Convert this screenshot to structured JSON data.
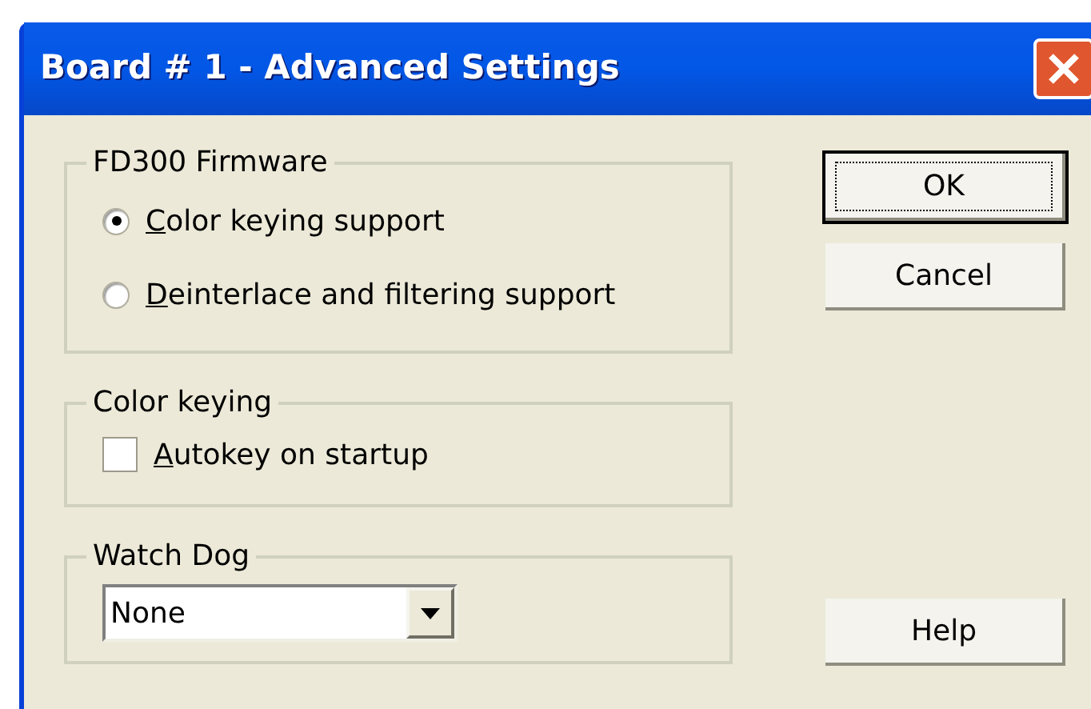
{
  "window": {
    "title": "Board # 1 - Advanced Settings"
  },
  "groups": [
    {
      "title": "FD300 Firmware",
      "items": [
        {
          "kind": "radio",
          "label": "Color keying support",
          "selected": true,
          "mnemonic_first": true
        },
        {
          "kind": "radio",
          "label": "Deinterlace and filtering support",
          "selected": false,
          "mnemonic_first": true
        }
      ]
    },
    {
      "title": "Color keying",
      "items": [
        {
          "kind": "checkbox",
          "label": "Autokey on startup",
          "checked": false,
          "mnemonic_first": true
        }
      ]
    },
    {
      "title": "Watch Dog",
      "items": [
        {
          "kind": "dropdown",
          "value": "None"
        }
      ]
    }
  ],
  "buttons": [
    {
      "label": "OK",
      "default": true
    },
    {
      "label": "Cancel",
      "default": false
    },
    {
      "label": "Help",
      "default": false
    }
  ]
}
